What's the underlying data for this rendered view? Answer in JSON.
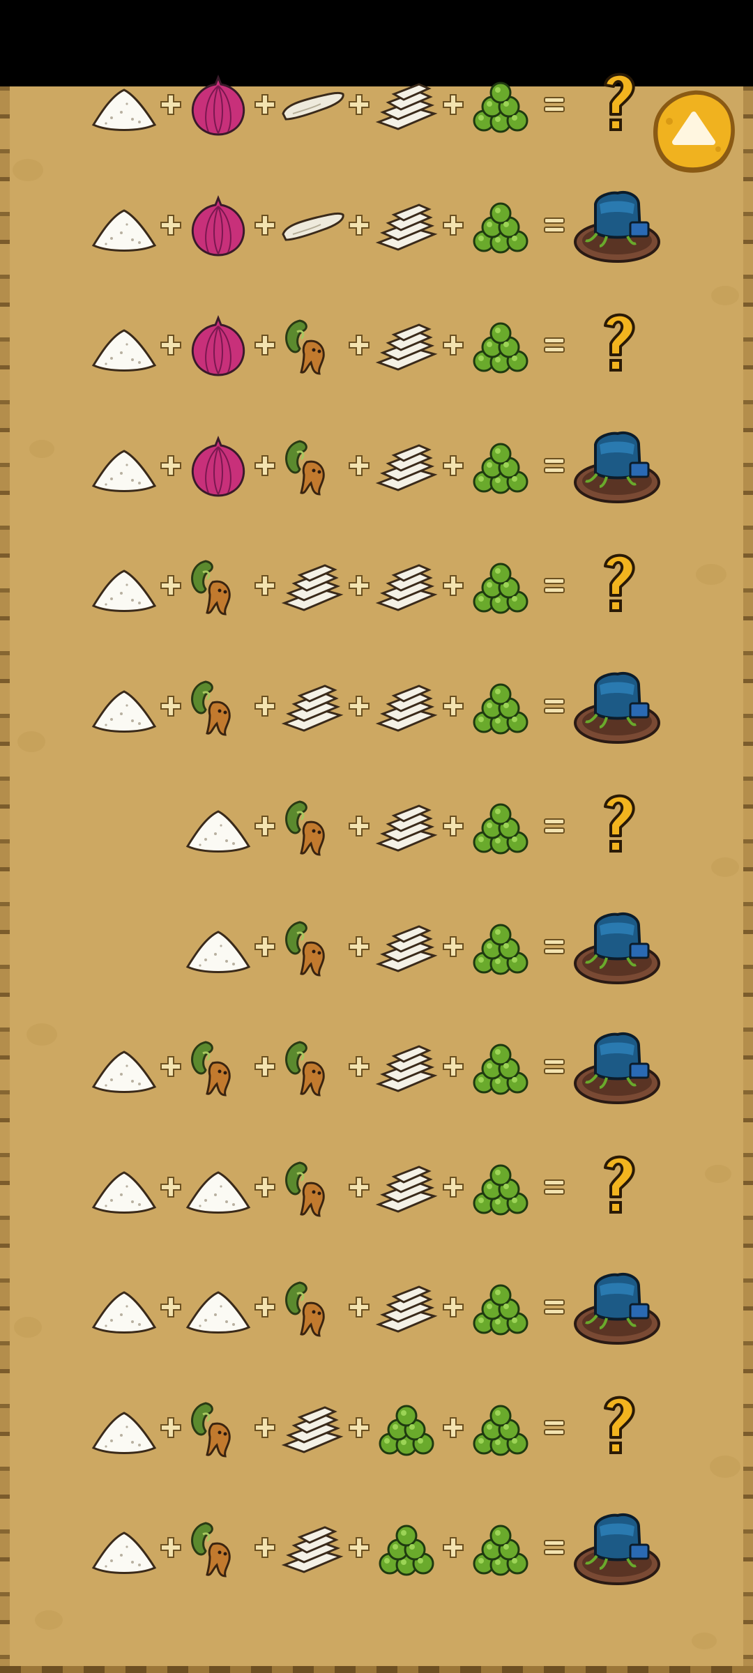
{
  "recipes": [
    {
      "ingredients": [
        "salt-pile",
        "red-onion",
        "white-root",
        "log-stack",
        "green-berries"
      ],
      "result": "unknown"
    },
    {
      "ingredients": [
        "salt-pile",
        "red-onion",
        "white-root",
        "log-stack",
        "green-berries"
      ],
      "result": "blue-machine"
    },
    {
      "ingredients": [
        "salt-pile",
        "red-onion",
        "mandrake-root",
        "log-stack",
        "green-berries"
      ],
      "result": "unknown"
    },
    {
      "ingredients": [
        "salt-pile",
        "red-onion",
        "mandrake-root",
        "log-stack",
        "green-berries"
      ],
      "result": "blue-machine"
    },
    {
      "ingredients": [
        "salt-pile",
        "mandrake-root",
        "log-stack",
        "log-stack",
        "green-berries"
      ],
      "result": "unknown"
    },
    {
      "ingredients": [
        "salt-pile",
        "mandrake-root",
        "log-stack",
        "log-stack",
        "green-berries"
      ],
      "result": "blue-machine"
    },
    {
      "ingredients": [
        "salt-pile",
        "mandrake-root",
        "log-stack",
        "green-berries"
      ],
      "result": "unknown"
    },
    {
      "ingredients": [
        "salt-pile",
        "mandrake-root",
        "log-stack",
        "green-berries"
      ],
      "result": "blue-machine"
    },
    {
      "ingredients": [
        "salt-pile",
        "mandrake-root",
        "mandrake-root",
        "log-stack",
        "green-berries"
      ],
      "result": "blue-machine"
    },
    {
      "ingredients": [
        "salt-pile",
        "salt-pile",
        "mandrake-root",
        "log-stack",
        "green-berries"
      ],
      "result": "unknown"
    },
    {
      "ingredients": [
        "salt-pile",
        "salt-pile",
        "mandrake-root",
        "log-stack",
        "green-berries"
      ],
      "result": "blue-machine"
    },
    {
      "ingredients": [
        "salt-pile",
        "mandrake-root",
        "log-stack",
        "green-berries",
        "green-berries"
      ],
      "result": "unknown"
    },
    {
      "ingredients": [
        "salt-pile",
        "mandrake-root",
        "log-stack",
        "green-berries",
        "green-berries"
      ],
      "result": "blue-machine"
    }
  ],
  "operators": {
    "plus": "plus-icon",
    "equals": "equals-icon"
  },
  "scroll_top_button": {
    "icon": "arrow-up-icon"
  },
  "colors": {
    "parchment": "#cda862",
    "operator": "#f3e3b0",
    "question_mark": "#f2b41f",
    "button_gold": "#f0b21f",
    "machine_blue": "#1c5a86"
  }
}
